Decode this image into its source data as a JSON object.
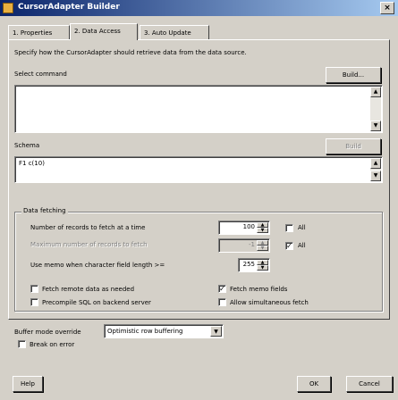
{
  "window": {
    "title": "CursorAdapter Builder",
    "close": "×"
  },
  "tabs": [
    "1. Properties",
    "2. Data Access",
    "3. Auto Update"
  ],
  "description": "Specify how the CursorAdapter should retrieve data from the data source.",
  "select_command": {
    "label": "Select command",
    "build_label": "Build...",
    "value": ""
  },
  "schema": {
    "label": "Schema",
    "build_label": "Build",
    "value": "F1 c(10)"
  },
  "data_fetching": {
    "title": "Data fetching",
    "rows": [
      {
        "label": "Number of records to fetch at a time",
        "value": "100",
        "all_label": "All",
        "all_checked": false,
        "enabled": true
      },
      {
        "label": "Maximum number of records to fetch",
        "value": "-1",
        "all_label": "All",
        "all_checked": true,
        "enabled": false
      },
      {
        "label": "Use memo when character field length >=",
        "value": "255",
        "enabled": true
      }
    ],
    "options": [
      {
        "label": "Fetch remote data as needed",
        "checked": false
      },
      {
        "label": "Fetch memo fields",
        "checked": true
      },
      {
        "label": "Precompile SQL on backend server",
        "checked": false
      },
      {
        "label": "Allow simultaneous fetch",
        "checked": false
      }
    ]
  },
  "buffer_mode": {
    "label": "Buffer mode override",
    "value": "Optimistic row buffering"
  },
  "break_on_error": {
    "label": "Break on error",
    "checked": false
  },
  "footer": {
    "help": "Help",
    "ok": "OK",
    "cancel": "Cancel"
  }
}
